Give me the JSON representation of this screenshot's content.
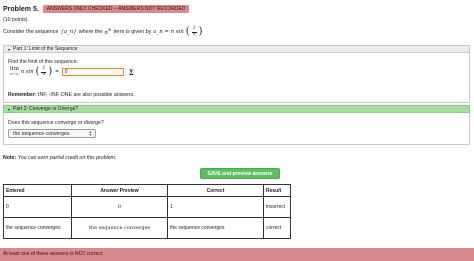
{
  "problem": {
    "title": "Problem 5.",
    "status_banner": "ANSWERS ONLY CHECKED -- ANSWERS NOT RECORDED",
    "points": "(10 points)",
    "intro_prefix": "Consider the sequence",
    "intro_seq_symbol": "{a_n}",
    "intro_mid": "where the",
    "intro_nth": "n",
    "intro_th": "th",
    "intro_suffix": "term is given by",
    "formula_lhs": "a_n = n sin"
  },
  "part1": {
    "header": "Part 1: Limit of the Sequence",
    "prompt": "Find the limit of this sequence:",
    "lim_word": "lim",
    "lim_sub": "n→∞",
    "expr": "n sin",
    "frac_num": "1",
    "frac_den": "n",
    "equals": "=",
    "answer_value": "0",
    "sigma_label": "Σ",
    "remember_label": "Remember:",
    "remember_text": "INF, -INF, DNE are also possible answers."
  },
  "part2": {
    "header": "Part 2: Converge or Diverge?",
    "question": "Does this sequence converge or diverge?",
    "selected_option": "the sequence converges"
  },
  "note": {
    "label": "Note:",
    "text": "You can earn partial credit on this problem."
  },
  "save_button_label": "SAVE and preview answers",
  "results": {
    "headers": [
      "Entered",
      "Answer Preview",
      "Correct",
      "Result"
    ],
    "rows": [
      [
        "0",
        "0",
        "1",
        "incorrect"
      ],
      [
        "the sequence converges",
        "the sequence converges",
        "the sequence converges",
        "correct"
      ]
    ]
  },
  "error_banner": "At least one of these answers is NOT correct.",
  "colors": {
    "status_banner": "#d98a8a",
    "part2_header": "#a6dca0",
    "save_button": "#5fbf62",
    "input_border": "#e08a2a"
  }
}
